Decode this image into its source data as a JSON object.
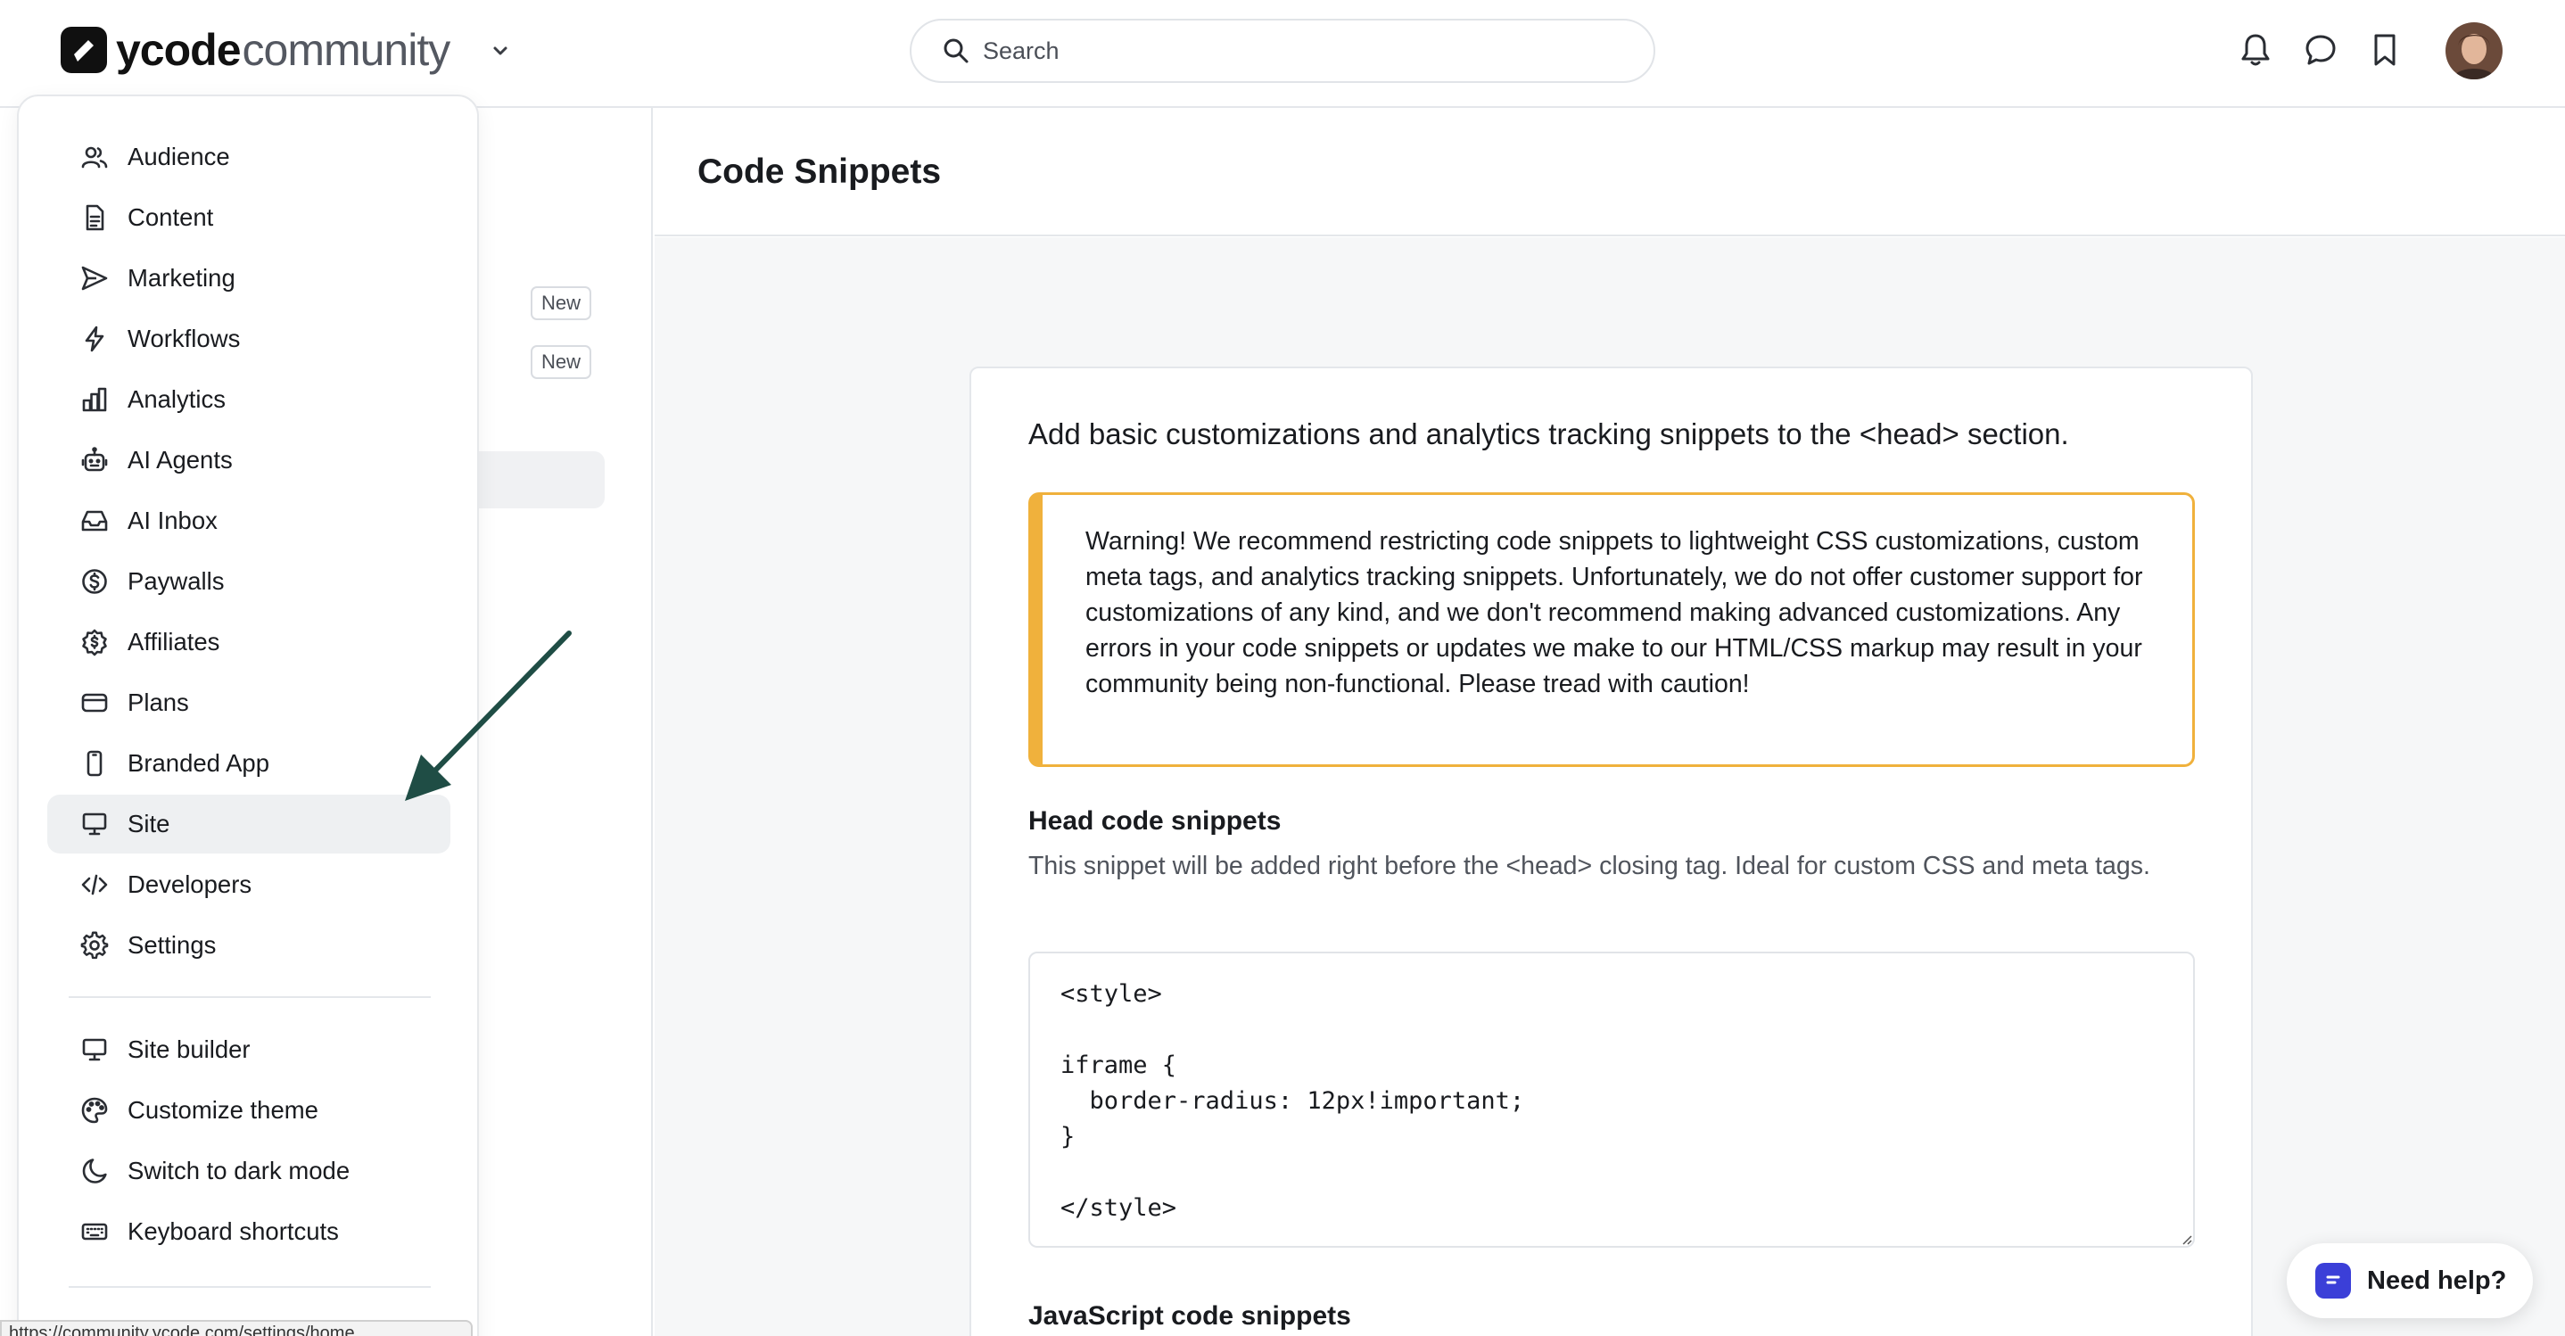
{
  "brand": {
    "name": "ycode",
    "suffix": "community"
  },
  "search": {
    "placeholder": "Search"
  },
  "background": {
    "badge_1": "New",
    "badge_2": "New"
  },
  "page": {
    "title": "Code Snippets"
  },
  "card": {
    "intro": "Add basic customizations and analytics tracking snippets to the <head> section.",
    "warning": "Warning! We recommend restricting code snippets to lightweight CSS customizations, custom meta tags, and analytics tracking snippets. Unfortunately, we do not offer customer support for customizations of any kind, and we don't recommend making advanced customizations. Any errors in your code snippets or updates we make to our HTML/CSS markup may result in your community being non-functional. Please tread with caution!",
    "head_title": "Head code snippets",
    "head_desc": "This snippet will be added right before the <head> closing tag. Ideal for custom CSS and meta tags.",
    "head_code": "<style>\n\niframe {\n  border-radius: 12px!important;\n}\n\n</style>",
    "js_title": "JavaScript code snippets"
  },
  "menu": {
    "items": [
      {
        "label": "Audience",
        "icon": "users-icon"
      },
      {
        "label": "Content",
        "icon": "document-icon"
      },
      {
        "label": "Marketing",
        "icon": "send-icon"
      },
      {
        "label": "Workflows",
        "icon": "lightning-icon"
      },
      {
        "label": "Analytics",
        "icon": "bar-chart-icon"
      },
      {
        "label": "AI Agents",
        "icon": "robot-icon"
      },
      {
        "label": "AI Inbox",
        "icon": "inbox-icon"
      },
      {
        "label": "Paywalls",
        "icon": "dollar-icon"
      },
      {
        "label": "Affiliates",
        "icon": "badge-dollar-icon"
      },
      {
        "label": "Plans",
        "icon": "credit-card-icon"
      },
      {
        "label": "Branded App",
        "icon": "phone-icon"
      },
      {
        "label": "Site",
        "icon": "monitor-icon",
        "active": true
      },
      {
        "label": "Developers",
        "icon": "code-icon"
      },
      {
        "label": "Settings",
        "icon": "gear-icon"
      }
    ],
    "secondary": [
      {
        "label": "Site builder",
        "icon": "monitor-icon"
      },
      {
        "label": "Customize theme",
        "icon": "palette-icon"
      },
      {
        "label": "Switch to dark mode",
        "icon": "moon-icon"
      },
      {
        "label": "Keyboard shortcuts",
        "icon": "keyboard-icon"
      }
    ]
  },
  "status_url": "https://community.ycode.com/settings/home",
  "help": {
    "label": "Need help?"
  },
  "colors": {
    "warning": "#f0b13c",
    "arrow": "#1f4d45",
    "help_icon": "#3b3fd8"
  }
}
